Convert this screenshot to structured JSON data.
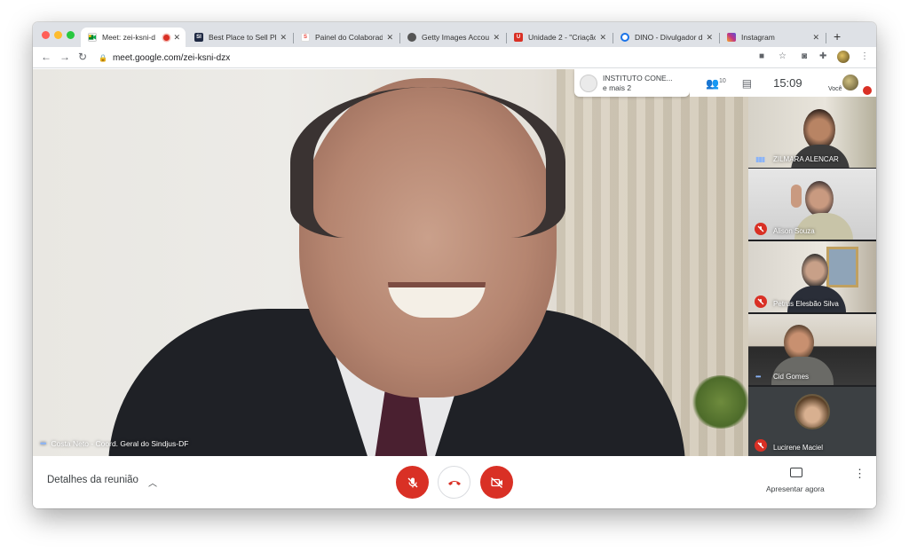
{
  "browser": {
    "tabs": [
      {
        "title": "Meet: zei-ksni-d",
        "active": true,
        "favicon": "google-meet-icon",
        "color": "#1a73e8"
      },
      {
        "title": "Best Place to Sell Ph",
        "favicon": "stockphoto-icon",
        "color": "#1f2a44"
      },
      {
        "title": "Painel do Colaborad",
        "favicon": "painel-icon",
        "color": "#e8443a"
      },
      {
        "title": "Getty Images Accou",
        "favicon": "getty-icon",
        "color": "#555555"
      },
      {
        "title": "Unidade 2 - \"Criação",
        "favicon": "unidade-icon",
        "color": "#d93025"
      },
      {
        "title": "DINO - Divulgador d",
        "favicon": "dino-icon",
        "color": "#1a73e8"
      },
      {
        "title": "Instagram",
        "favicon": "instagram-icon",
        "color": "#c13584"
      }
    ],
    "new_tab": "+",
    "url": "meet.google.com/zei-ksni-dzx"
  },
  "meeting": {
    "org_name": "INSTITUTO CONE...",
    "org_more": "e mais 2",
    "people_count": "10",
    "time": "15:09",
    "you_label": "Você",
    "main_speaker": "Costa Neto - Coord. Geral do Sindjus-DF",
    "participants": [
      {
        "name": "ZILMARA ALENCAR",
        "muted": false
      },
      {
        "name": "Alison Souza",
        "muted": true
      },
      {
        "name": "Petrus Elesbão Silva",
        "muted": true
      },
      {
        "name": "Cid Gomes",
        "muted": false
      },
      {
        "name": "Lucirene Maciel",
        "muted": true
      }
    ]
  },
  "bottom": {
    "details_label": "Detalhes da reunião",
    "present_label": "Apresentar agora"
  },
  "colors": {
    "danger": "#d93025",
    "accent": "#8ab4f8",
    "text": "#3c4043"
  }
}
